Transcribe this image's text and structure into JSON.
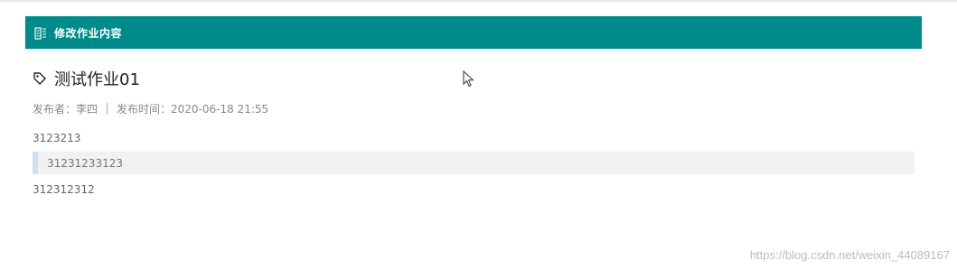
{
  "header": {
    "title": "修改作业内容",
    "icon": "document-edit-icon",
    "color": "#008b8b"
  },
  "homework": {
    "title": "测试作业01",
    "publisher_label": "发布者：李四",
    "publish_time_label": "发布时间：2020-06-18 21:55"
  },
  "content": {
    "line1": "3123213",
    "quote": "31231233123",
    "line3": "312312312"
  },
  "watermark": "https://blog.csdn.net/weixin_44089167"
}
